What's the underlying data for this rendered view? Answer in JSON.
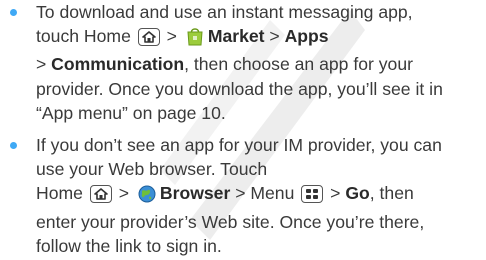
{
  "colors": {
    "bullet": "#3fa9f5",
    "text": "#3a3a3a",
    "watermark": "#e9e9e9"
  },
  "icons": {
    "home_key": "home-icon",
    "market_app": "market-bag-icon",
    "browser_app": "globe-icon",
    "menu_key": "menu-grid-icon"
  },
  "items": [
    {
      "l1": "To download and use an instant messaging app,",
      "l2_pre": "touch Home",
      "sep1": ">",
      "market": "Market",
      "sep2": ">",
      "apps": "Apps",
      "l3_sep": ">",
      "communication": "Communication",
      "l3_post": ", then choose an app for your",
      "l4": "provider. Once you download the app, you’ll see it in",
      "l5": "“App menu” on page 10."
    },
    {
      "l1": "If you don’t see an app for your IM provider, you can",
      "l2": "use your Web browser. Touch",
      "l3_pre": "Home",
      "sep1": ">",
      "browser": "Browser",
      "sep2": "> Menu",
      "sep3": ">",
      "go": "Go",
      "l3_post": ", then",
      "l4": "enter your provider’s Web site. Once you’re there,",
      "l5": "follow the link to sign in."
    }
  ]
}
